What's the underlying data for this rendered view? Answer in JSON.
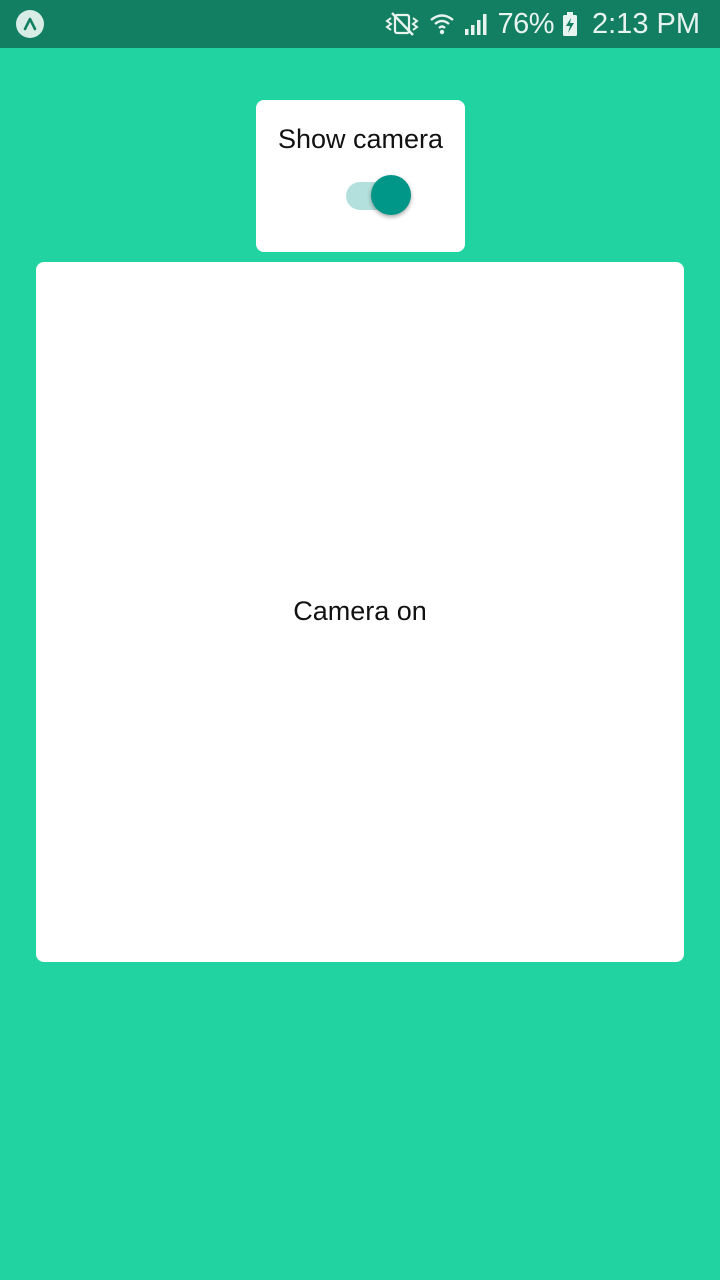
{
  "status_bar": {
    "app_icon": "expo-icon",
    "icons": [
      "vibrate-mute-icon",
      "wifi-icon",
      "cell-signal-icon",
      "battery-charging-icon"
    ],
    "battery": "76%",
    "time": "2:13 PM",
    "background_color": "#137f62"
  },
  "toggle": {
    "label": "Show camera",
    "on": true,
    "thumb_color": "#009688",
    "track_color": "#b3e0dc"
  },
  "camera": {
    "status_text": "Camera on"
  },
  "colors": {
    "background": "#21d3a0",
    "card": "#ffffff"
  }
}
